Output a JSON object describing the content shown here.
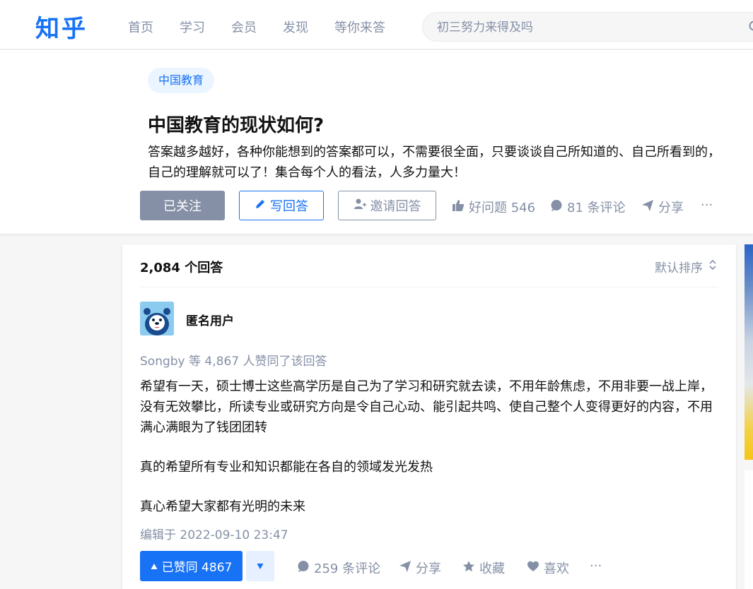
{
  "header": {
    "logo": "知乎",
    "nav": [
      "首页",
      "学习",
      "会员",
      "发现",
      "等你来答"
    ],
    "search_placeholder": "初三努力来得及吗"
  },
  "question": {
    "topic": "中国教育",
    "title": "中国教育的现状如何?",
    "detail": "答案越多越好，各种你能想到的答案都可以，不需要很全面，只要谈谈自己所知道的、自己所看到的，自己的理解就可以了！集合每个人的看法，人多力量大！",
    "followed_label": "已关注",
    "write_answer_label": "写回答",
    "invite_label": "邀请回答",
    "good_question_label": "好问题 546",
    "comments_label": "81 条评论",
    "share_label": "分享",
    "more_label": "···"
  },
  "answers": {
    "count_label": "2,084 个回答",
    "sort_label": "默认排序",
    "first": {
      "author": "匿名用户",
      "voters": "Songby 等 4,867 人赞同了该回答",
      "paragraphs": [
        "希望有一天，硕士博士这些高学历是自己为了学习和研究就去读，不用年龄焦虑，不用非要一战上岸，没有无效攀比，所读专业或研究方向是令自己心动、能引起共鸣、使自己整个人变得更好的内容，不用满心满眼为了钱团团转",
        "真的希望所有专业和知识都能在各自的领域发光发热",
        "真心希望大家都有光明的未来"
      ],
      "edited": "编辑于 2022-09-10 23:47",
      "vote_label": "已赞同 4867",
      "comments_label": "259 条评论",
      "share_label": "分享",
      "collect_label": "收藏",
      "like_label": "喜欢",
      "more_label": "···"
    }
  },
  "colors": {
    "brand": "#1772f6",
    "muted": "#8590a6",
    "tag_bg": "#ebf5ff"
  }
}
